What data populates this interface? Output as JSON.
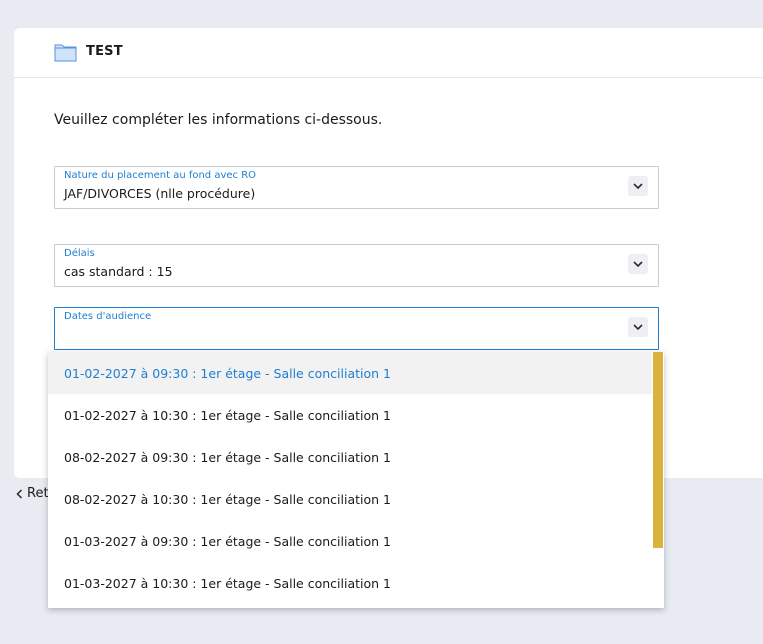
{
  "card": {
    "title": "TEST",
    "intro": "Veuillez compléter les informations ci-dessous."
  },
  "fields": [
    {
      "label": "Nature du placement au fond avec RO",
      "value": "JAF/DIVORCES (nlle procédure)"
    },
    {
      "label": "Délais",
      "value": "cas standard : 15"
    },
    {
      "label": "Dates d'audience",
      "value": ""
    }
  ],
  "back_link": {
    "label": "Ret"
  },
  "dropdown": {
    "options": [
      "01-02-2027 à 09:30 : 1er étage - Salle conciliation 1",
      "01-02-2027 à 10:30 : 1er étage - Salle conciliation 1",
      "08-02-2027 à 09:30 : 1er étage - Salle conciliation 1",
      "08-02-2027 à 10:30 : 1er étage - Salle conciliation 1",
      "01-03-2027 à 09:30 : 1er étage - Salle conciliation 1",
      "01-03-2027 à 10:30 : 1er étage - Salle conciliation 1"
    ],
    "highlighted_index": 0
  },
  "icons": {
    "folder": "folder-icon",
    "chevron": "chevron-down-icon",
    "back": "chevron-left-icon"
  },
  "colors": {
    "accent": "#1f7ed0",
    "scrollbar": "#d9b33e",
    "background": "#e8ecf2"
  }
}
